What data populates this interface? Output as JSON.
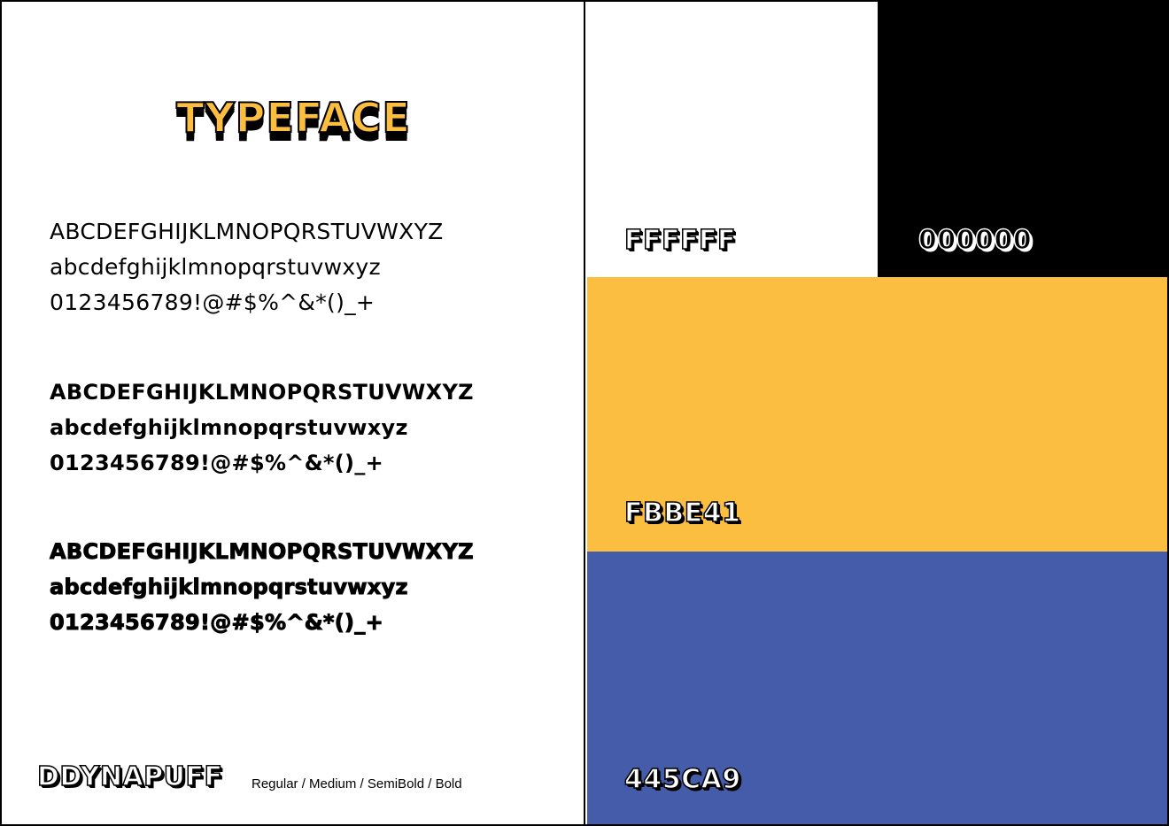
{
  "typeface": {
    "title": "TYPEFACE",
    "specimens": [
      {
        "weight": "Regular",
        "lines": [
          "ABCDEFGHIJKLMNOPQRSTUVWXYZ",
          "abcdefghijklmnopqrstuvwxyz",
          "0123456789!@#$%^&*()_+"
        ]
      },
      {
        "weight": "SemiBold",
        "lines": [
          "ABCDEFGHIJKLMNOPQRSTUVWXYZ",
          "abcdefghijklmnopqrstuvwxyz",
          "0123456789!@#$%^&*()_+"
        ]
      },
      {
        "weight": "Bold",
        "lines": [
          "ABCDEFGHIJKLMNOPQRSTUVWXYZ",
          "abcdefghijklmnopqrstuvwxyz",
          "0123456789!@#$%^&*()_+"
        ]
      }
    ],
    "font_name": "DDYNAPUFF",
    "weights_label": "Regular / Medium / SemiBold / Bold"
  },
  "palette": {
    "white": {
      "hex": "FFFFFF",
      "color": "#FFFFFF"
    },
    "black": {
      "hex": "000000",
      "color": "#000000"
    },
    "yellow": {
      "hex": "FBBE41",
      "color": "#FBBE41"
    },
    "blue": {
      "hex": "445CA9",
      "color": "#445CA9"
    }
  }
}
